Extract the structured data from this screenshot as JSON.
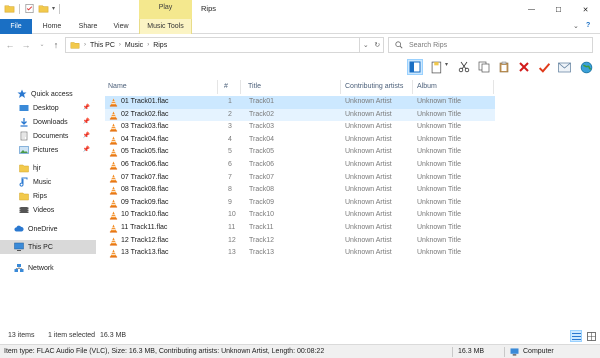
{
  "window": {
    "title": "Rips",
    "contextual_group": "Play",
    "controls": {
      "minimize": "—",
      "maximize": "☐",
      "close": "✕"
    }
  },
  "ribbon": {
    "tabs": [
      {
        "label": "File"
      },
      {
        "label": "Home"
      },
      {
        "label": "Share"
      },
      {
        "label": "View"
      },
      {
        "label": "Music Tools"
      }
    ]
  },
  "address": {
    "crumbs": [
      "This PC",
      "Music",
      "Rips"
    ],
    "search_placeholder": "Search Rips"
  },
  "nav": {
    "items": [
      {
        "label": "Quick access",
        "icon": "star-icon"
      },
      {
        "label": "Desktop",
        "icon": "desktop-folder-icon",
        "pinned": true
      },
      {
        "label": "Downloads",
        "icon": "downloads-folder-icon",
        "pinned": true
      },
      {
        "label": "Documents",
        "icon": "documents-folder-icon",
        "pinned": true
      },
      {
        "label": "Pictures",
        "icon": "pictures-folder-icon",
        "pinned": true
      },
      {
        "label": "hjr",
        "icon": "folder-icon"
      },
      {
        "label": "Music",
        "icon": "music-folder-icon"
      },
      {
        "label": "Rips",
        "icon": "folder-icon"
      },
      {
        "label": "Videos",
        "icon": "videos-folder-icon"
      },
      {
        "label": "OneDrive",
        "icon": "cloud-icon"
      },
      {
        "label": "This PC",
        "icon": "computer-icon",
        "selected": true
      },
      {
        "label": "Network",
        "icon": "network-icon"
      }
    ]
  },
  "columns": {
    "name": "Name",
    "number": "#",
    "title": "Title",
    "artist": "Contributing artists",
    "album": "Album"
  },
  "files": [
    {
      "name": "01 Track01.flac",
      "num": "1",
      "title": "Track01",
      "artist": "Unknown Artist",
      "album": "Unknown Title"
    },
    {
      "name": "02 Track02.flac",
      "num": "2",
      "title": "Track02",
      "artist": "Unknown Artist",
      "album": "Unknown Title"
    },
    {
      "name": "03 Track03.flac",
      "num": "3",
      "title": "Track03",
      "artist": "Unknown Artist",
      "album": "Unknown Title"
    },
    {
      "name": "04 Track04.flac",
      "num": "4",
      "title": "Track04",
      "artist": "Unknown Artist",
      "album": "Unknown Title"
    },
    {
      "name": "05 Track05.flac",
      "num": "5",
      "title": "Track05",
      "artist": "Unknown Artist",
      "album": "Unknown Title"
    },
    {
      "name": "06 Track06.flac",
      "num": "6",
      "title": "Track06",
      "artist": "Unknown Artist",
      "album": "Unknown Title"
    },
    {
      "name": "07 Track07.flac",
      "num": "7",
      "title": "Track07",
      "artist": "Unknown Artist",
      "album": "Unknown Title"
    },
    {
      "name": "08 Track08.flac",
      "num": "8",
      "title": "Track08",
      "artist": "Unknown Artist",
      "album": "Unknown Title"
    },
    {
      "name": "09 Track09.flac",
      "num": "9",
      "title": "Track09",
      "artist": "Unknown Artist",
      "album": "Unknown Title"
    },
    {
      "name": "10 Track10.flac",
      "num": "10",
      "title": "Track10",
      "artist": "Unknown Artist",
      "album": "Unknown Title"
    },
    {
      "name": "11 Track11.flac",
      "num": "11",
      "title": "Track11",
      "artist": "Unknown Artist",
      "album": "Unknown Title"
    },
    {
      "name": "12 Track12.flac",
      "num": "12",
      "title": "Track12",
      "artist": "Unknown Artist",
      "album": "Unknown Title"
    },
    {
      "name": "13 Track13.flac",
      "num": "13",
      "title": "Track13",
      "artist": "Unknown Artist",
      "album": "Unknown Title"
    }
  ],
  "status": {
    "count": "13 items",
    "selection": "1 item selected",
    "selection_size": "16.3 MB"
  },
  "details": {
    "info": "Item type: FLAC Audio File (VLC), Size: 16.3 MB, Contributing artists: Unknown Artist, Length: 00:08:22",
    "size": "16.3 MB",
    "location": "Computer"
  },
  "colors": {
    "accent": "#1a6fc4",
    "selected_row": "#cce8ff",
    "hover_row": "#e5f3ff",
    "contextual_tab": "#f4e88e"
  }
}
